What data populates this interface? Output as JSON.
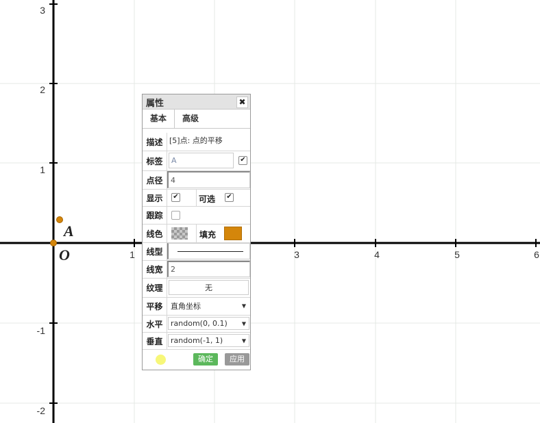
{
  "graph": {
    "x_ticks": [
      "1",
      "3",
      "4",
      "5",
      "6"
    ],
    "y_ticks": [
      "3",
      "2",
      "1",
      "-1",
      "-2"
    ],
    "origin_label": "O",
    "point_label": "A"
  },
  "panel": {
    "title": "属性",
    "close_glyph": "✖",
    "tabs": [
      "基本",
      "高级"
    ],
    "rows": {
      "desc": {
        "label": "描述",
        "value": "[5]点: 点的平移"
      },
      "label": {
        "label": "标签",
        "value": "A",
        "checked": "✔"
      },
      "size": {
        "label": "点径",
        "value": "4"
      },
      "show": {
        "label": "显示",
        "checked": "✔"
      },
      "selectable": {
        "label": "可选",
        "checked": "✔"
      },
      "trace": {
        "label": "跟踪"
      },
      "line_color": {
        "label": "线色"
      },
      "fill": {
        "label": "填充",
        "color": "#d4860b"
      },
      "line_type": {
        "label": "线型"
      },
      "line_width": {
        "label": "线宽",
        "value": "2"
      },
      "texture": {
        "label": "纹理",
        "value": "无"
      },
      "translate": {
        "label": "平移",
        "value": "直角坐标"
      },
      "horizontal": {
        "label": "水平",
        "value": "random(0, 0.1)"
      },
      "vertical": {
        "label": "垂直",
        "value": "random(-1, 1)"
      }
    },
    "buttons": {
      "ok": "确定",
      "apply": "应用"
    }
  },
  "colors": {
    "accent_green": "#5cb85c",
    "gray_button": "#999999",
    "point": "#d4860b"
  }
}
